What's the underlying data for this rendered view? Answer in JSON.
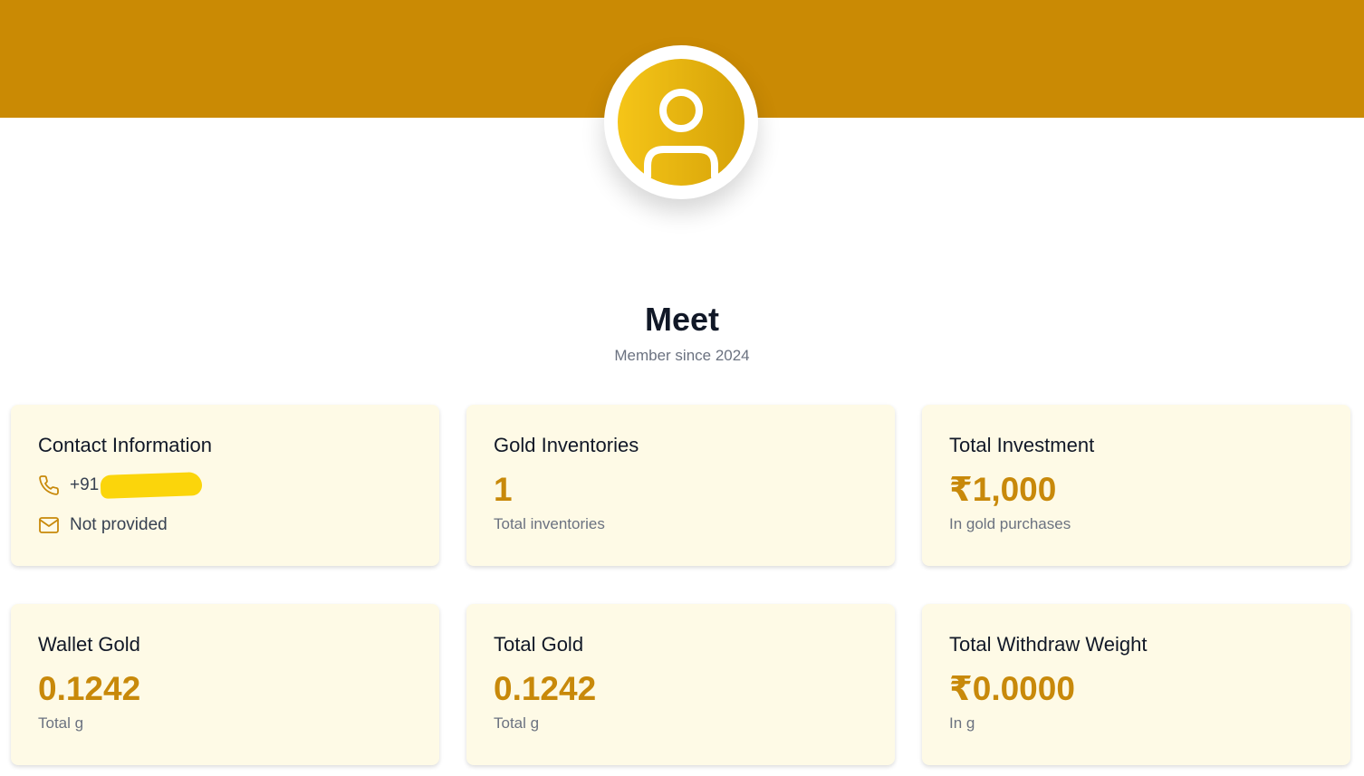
{
  "profile": {
    "name": "Meet",
    "member_since": "Member since 2024"
  },
  "contact": {
    "title": "Contact Information",
    "phone": "+91",
    "email": "Not provided"
  },
  "stats": {
    "inventories": {
      "title": "Gold Inventories",
      "value": "1",
      "sub": "Total inventories"
    },
    "investment": {
      "title": "Total Investment",
      "value": "₹1,000",
      "sub": "In gold purchases"
    },
    "wallet": {
      "title": "Wallet Gold",
      "value": "0.1242",
      "sub": "Total g"
    },
    "total_gold": {
      "title": "Total Gold",
      "value": "0.1242",
      "sub": "Total g"
    },
    "withdraw": {
      "title": "Total Withdraw Weight",
      "value": "₹0.0000",
      "sub": "In g"
    }
  },
  "colors": {
    "banner": "#ca8a04",
    "accent_value": "#c8890a",
    "card_bg": "#fefae6",
    "redaction": "#fbd50b"
  },
  "icons": {
    "avatar": "user-icon",
    "phone": "phone-icon",
    "email": "mail-icon"
  }
}
